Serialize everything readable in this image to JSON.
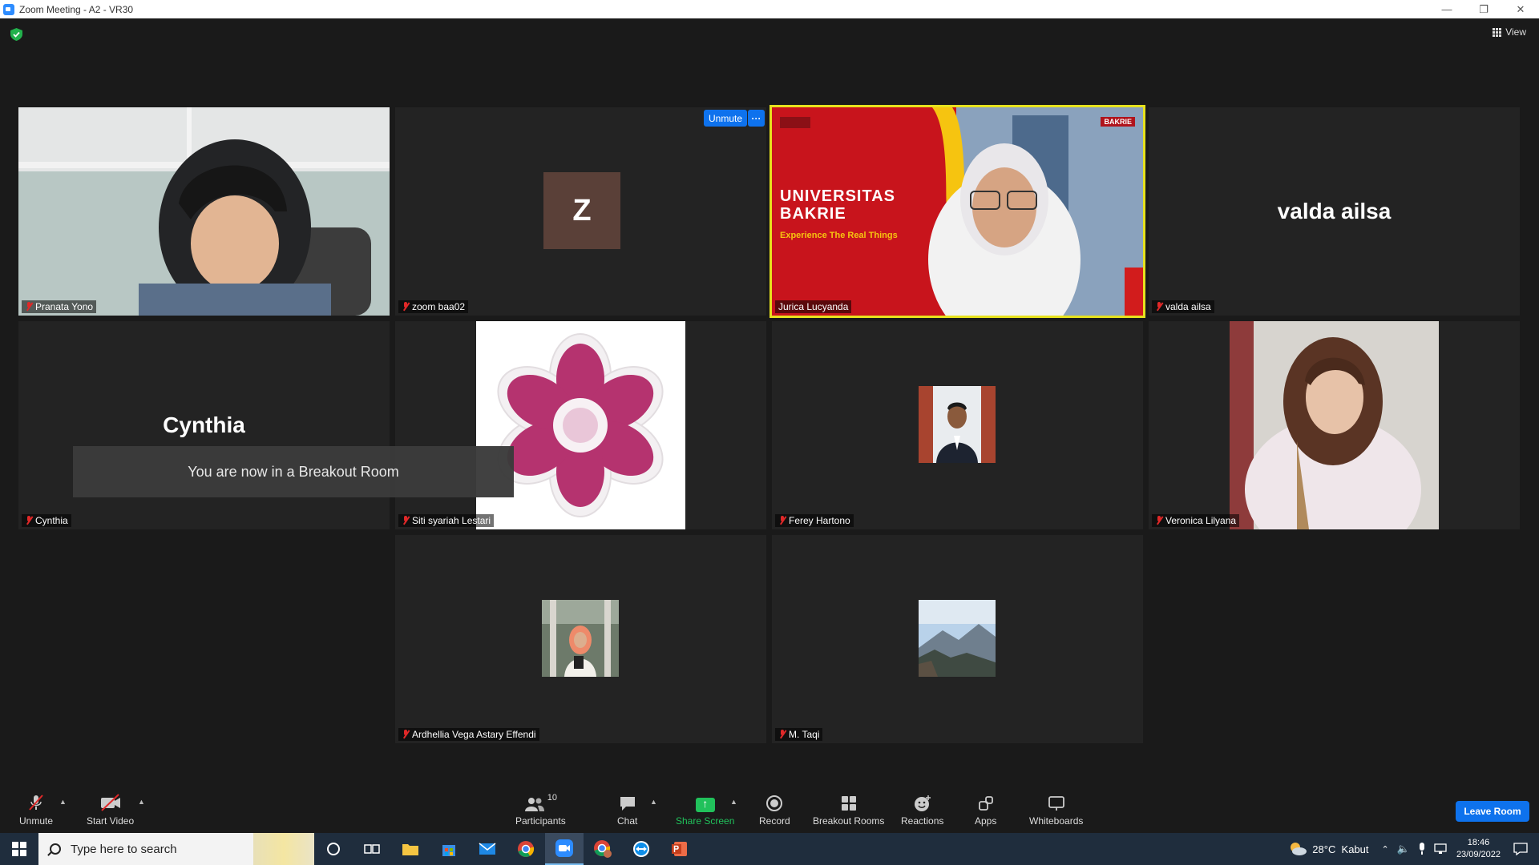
{
  "window": {
    "title": "Zoom Meeting - A2 - VR30"
  },
  "top_bar": {
    "view_label": "View"
  },
  "tiles": [
    {
      "name": "Pranata Yono"
    },
    {
      "name": "zoom baa02",
      "avatar_letter": "Z"
    },
    {
      "name": "Jurica Lucyanda",
      "banner_title": "UNIVERSITAS BAKRIE",
      "banner_subtitle": "Experience The Real Things",
      "logo_text": "BAKRIE"
    },
    {
      "name": "valda ailsa",
      "display_name": "valda ailsa"
    },
    {
      "name": "Cynthia",
      "display_name": "Cynthia"
    },
    {
      "name": "Siti syariah Lestari"
    },
    {
      "name": "Ferey Hartono"
    },
    {
      "name": "Veronica Lilyana"
    },
    {
      "name": "Ardhellia Vega Astary Effendi"
    },
    {
      "name": "M. Taqi"
    }
  ],
  "self_controls": {
    "unmute_label": "Unmute",
    "more_label": "···"
  },
  "breakout_toast": "You are now in a Breakout Room",
  "toolbar": {
    "unmute": "Unmute",
    "start_video": "Start Video",
    "participants": "Participants",
    "participants_count": "10",
    "chat": "Chat",
    "share_screen": "Share Screen",
    "record": "Record",
    "breakout_rooms": "Breakout Rooms",
    "reactions": "Reactions",
    "apps": "Apps",
    "whiteboards": "Whiteboards",
    "leave_room": "Leave Room"
  },
  "taskbar": {
    "search_placeholder": "Type here to search",
    "weather": "28°C  Kabut",
    "time": "18:46",
    "date": "23/09/2022"
  },
  "colors": {
    "accent": "#0e72ed",
    "active_border": "#e7e21e",
    "mute_red": "#e02828",
    "share_green": "#21c15b"
  }
}
